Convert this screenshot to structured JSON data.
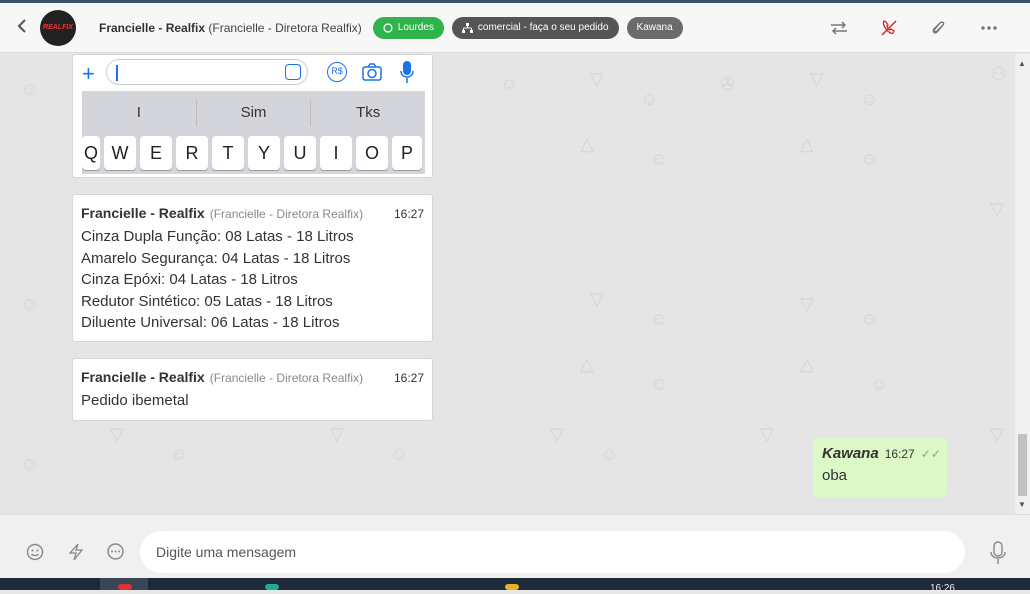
{
  "header": {
    "back_icon": "chevron-left-icon",
    "avatar_text": "REALFIX",
    "contact_name": "Francielle - Realfix",
    "contact_sub": "(Francielle - Diretora Realfix)",
    "tags": [
      {
        "label": "Lourdes",
        "color": "#2fb34a",
        "icon": "whatsapp-icon"
      },
      {
        "label": "comercial - faça o seu pedido",
        "color": "#555555",
        "icon": "org-chart-icon"
      },
      {
        "label": "Kawana",
        "color": "#6b6b6b"
      }
    ],
    "actions": [
      "transfer-icon",
      "end-call-icon",
      "attach-icon",
      "more-icon"
    ]
  },
  "image_message": {
    "suggestions": [
      "I",
      "Sim",
      "Tks"
    ],
    "keys": [
      "Q",
      "W",
      "E",
      "R",
      "T",
      "Y",
      "U",
      "I",
      "O",
      "P"
    ]
  },
  "messages": [
    {
      "sender": "Francielle - Realfix",
      "role": "(Francielle - Diretora Realfix)",
      "time": "16:27",
      "lines": [
        "Cinza Dupla Função: 08 Latas - 18 Litros",
        "Amarelo Segurança: 04 Latas - 18 Litros",
        "Cinza Epóxi: 04 Latas - 18 Litros",
        "Redutor Sintético: 05 Latas - 18 Litros",
        "Diluente Universal: 06 Latas - 18 Litros"
      ]
    },
    {
      "sender": "Francielle - Realfix",
      "role": "(Francielle - Diretora Realfix)",
      "time": "16:27",
      "lines": [
        "Pedido ibemetal"
      ]
    }
  ],
  "outgoing": {
    "sender": "Kawana",
    "time": "16:27",
    "text": "oba"
  },
  "composer": {
    "placeholder": "Digite uma mensagem"
  },
  "taskbar": {
    "clock": "16:26"
  }
}
